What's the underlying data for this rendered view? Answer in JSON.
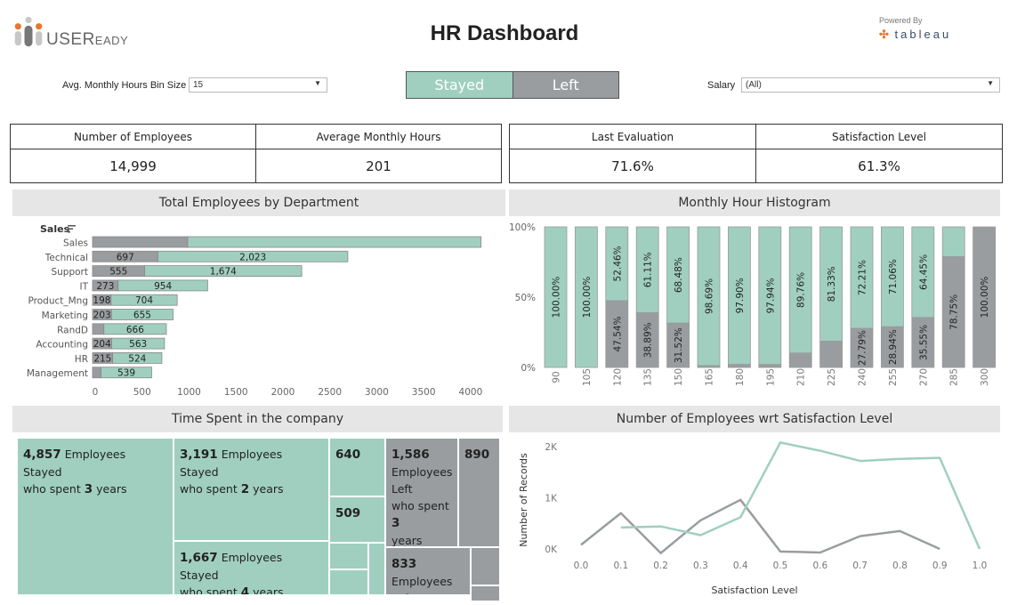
{
  "header": {
    "logo_text_main": "USER",
    "logo_text_small": "EADY",
    "title": "HR Dashboard",
    "powered_by": "Powered By",
    "tableau_text": "tableau"
  },
  "filters": {
    "bin_size": {
      "label": "Avg. Monthly Hours Bin Size",
      "value": "15"
    },
    "salary": {
      "label": "Salary",
      "value": "(All)"
    },
    "toggle": {
      "stayed": "Stayed",
      "left": "Left"
    }
  },
  "colors": {
    "stayed": "#a0cfbf",
    "left": "#999da0",
    "title_bg": "#e6e6e6"
  },
  "kpis": [
    {
      "label": "Number of Employees",
      "value": "14,999"
    },
    {
      "label": "Average Monthly Hours",
      "value": "201"
    },
    {
      "label": "Last Evaluation",
      "value": "71.6%"
    },
    {
      "label": "Satisfaction Level",
      "value": "61.3%"
    }
  ],
  "panels": {
    "dept": "Total Employees by Department",
    "hist": "Monthly Hour Histogram",
    "tenure": "Time Spent in the company",
    "satisfaction": "Number of Employees wrt Satisfaction Level"
  },
  "treemap": {
    "cells": [
      {
        "value": "4,857",
        "line1": "Employees Stayed",
        "pre": "who spent",
        "years": "3",
        "post": "years",
        "status": "stayed"
      },
      {
        "value": "3,191",
        "line1": "Employees Stayed",
        "pre": "who spent",
        "years": "2",
        "post": "years",
        "status": "stayed"
      },
      {
        "value": "1,667",
        "line1": "Employees Stayed",
        "pre": "who spent",
        "years": "4",
        "post": "years",
        "status": "stayed"
      },
      {
        "value": "640",
        "status": "stayed"
      },
      {
        "value": "509",
        "status": "stayed"
      },
      {
        "value": "1,586",
        "line1": "Employees",
        "line2": "Left",
        "pre": "who spent",
        "years": "3",
        "post": "years",
        "status": "left"
      },
      {
        "value": "890",
        "status": "left"
      },
      {
        "value": "833",
        "line1": "Employees Left",
        "status": "left"
      }
    ]
  },
  "chart_data": [
    {
      "type": "bar",
      "title": "Total Employees by Department",
      "orientation": "horizontal-stacked",
      "sort_label": "Sales",
      "categories": [
        "Sales",
        "Technical",
        "Support",
        "IT",
        "Product_Mng",
        "Marketing",
        "RandD",
        "Accounting",
        "HR",
        "Management"
      ],
      "series": [
        {
          "name": "Left",
          "values": [
            1014,
            697,
            555,
            273,
            198,
            203,
            121,
            204,
            215,
            91
          ],
          "labels": [
            "",
            "697",
            "555",
            "273",
            "198",
            "203",
            "",
            "204",
            "215",
            ""
          ]
        },
        {
          "name": "Stayed",
          "values": [
            3126,
            2023,
            1674,
            954,
            704,
            655,
            666,
            563,
            524,
            539
          ],
          "labels": [
            "",
            "2,023",
            "1,674",
            "954",
            "704",
            "655",
            "666",
            "563",
            "524",
            "539"
          ]
        }
      ],
      "xticks": [
        "0",
        "500",
        "1000",
        "1500",
        "2000",
        "2500",
        "3000",
        "3500",
        "4000"
      ],
      "xlim": [
        0,
        4200
      ]
    },
    {
      "type": "bar",
      "title": "Monthly Hour Histogram",
      "orientation": "vertical-stacked-100",
      "categories": [
        "90",
        "105",
        "120",
        "135",
        "150",
        "165",
        "180",
        "195",
        "210",
        "225",
        "240",
        "255",
        "270",
        "285",
        "300"
      ],
      "series": [
        {
          "name": "Left",
          "values": [
            0,
            0,
            47.54,
            38.89,
            31.52,
            1.31,
            2.1,
            2.06,
            10.24,
            18.67,
            27.79,
            28.94,
            35.55,
            78.75,
            100.0
          ],
          "labels": [
            "",
            "",
            "47.54%",
            "38.89%",
            "31.52%",
            "",
            "",
            "",
            "",
            "",
            "27.79%",
            "28.94%",
            "35.55%",
            "78.75%",
            "100.00%"
          ]
        },
        {
          "name": "Stayed",
          "values": [
            100.0,
            100.0,
            52.46,
            61.11,
            68.48,
            98.69,
            97.9,
            97.94,
            89.76,
            81.33,
            72.21,
            71.06,
            64.45,
            21.25,
            0
          ],
          "labels": [
            "100.00%",
            "100.00%",
            "52.46%",
            "61.11%",
            "68.48%",
            "98.69%",
            "97.90%",
            "97.94%",
            "89.76%",
            "81.33%",
            "72.21%",
            "71.06%",
            "64.45%",
            "",
            ""
          ]
        }
      ],
      "yticks": [
        "0%",
        "50%",
        "100%"
      ],
      "ylim": [
        0,
        100
      ]
    },
    {
      "type": "line",
      "title": "Number of Employees wrt Satisfaction Level",
      "xlabel": "Satisfaction Level",
      "ylabel": "Number of Records",
      "x": [
        0.0,
        0.1,
        0.2,
        0.3,
        0.4,
        0.5,
        0.6,
        0.7,
        0.8,
        0.9,
        1.0
      ],
      "xticks": [
        "0.0",
        "0.1",
        "0.2",
        "0.3",
        "0.4",
        "0.5",
        "0.6",
        "0.7",
        "0.8",
        "0.9",
        "1.0"
      ],
      "yticks": [
        "0K",
        "1K",
        "2K"
      ],
      "ylim": [
        -100,
        2150
      ],
      "series": [
        {
          "name": "Left",
          "values": [
            80,
            700,
            -80,
            560,
            960,
            -50,
            -70,
            250,
            350,
            0,
            null
          ]
        },
        {
          "name": "Stayed",
          "values": [
            null,
            420,
            440,
            270,
            620,
            2080,
            1920,
            1720,
            1760,
            1780,
            0
          ]
        }
      ]
    }
  ]
}
